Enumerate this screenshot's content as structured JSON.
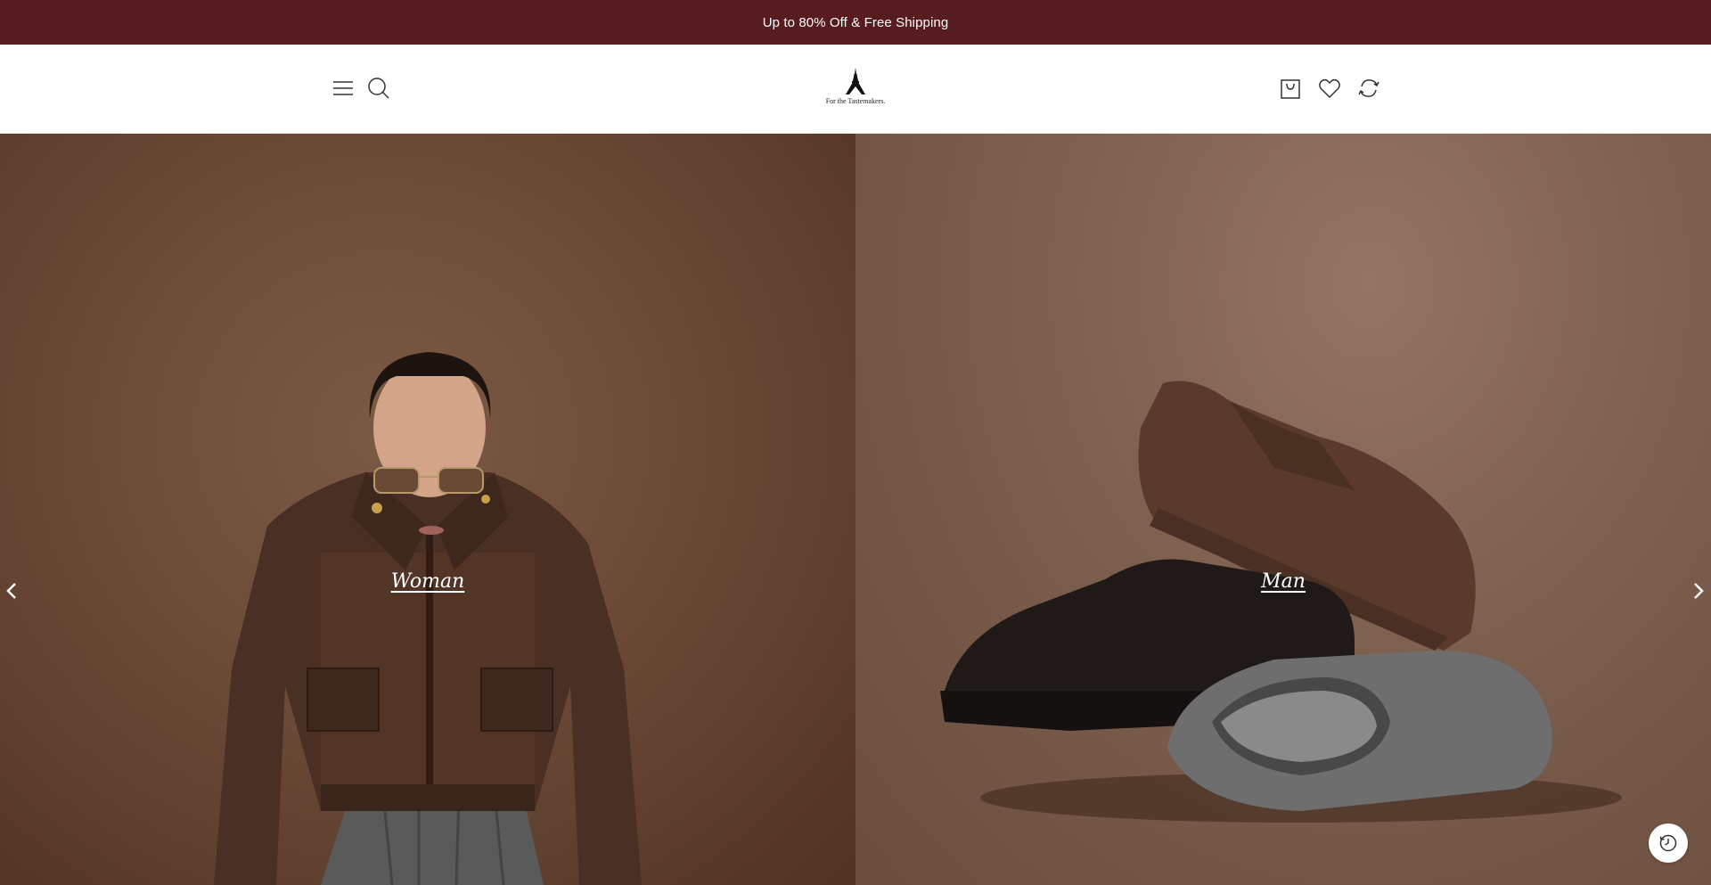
{
  "announcement": {
    "text": "Up to 80% Off & Free Shipping"
  },
  "header": {
    "logo": {
      "tagline": "For the Tastemakers.",
      "icon": "eiffel-tower-logo"
    },
    "left_icons": [
      "menu-icon",
      "search-icon"
    ],
    "right_icons": [
      "bag-icon",
      "heart-icon",
      "refresh-icon"
    ]
  },
  "hero": {
    "panels": [
      {
        "label": "Woman",
        "image": "woman-brown-suede-jacket"
      },
      {
        "label": "Man",
        "image": "suede-sneakers"
      }
    ],
    "prev_icon": "chevron-left-icon",
    "next_icon": "chevron-right-icon"
  },
  "floating": {
    "history_icon": "clock-history-icon"
  },
  "colors": {
    "announcement_bg": "#571c1f",
    "hero_left": "#6b4a36",
    "hero_right": "#7d5f4e"
  }
}
